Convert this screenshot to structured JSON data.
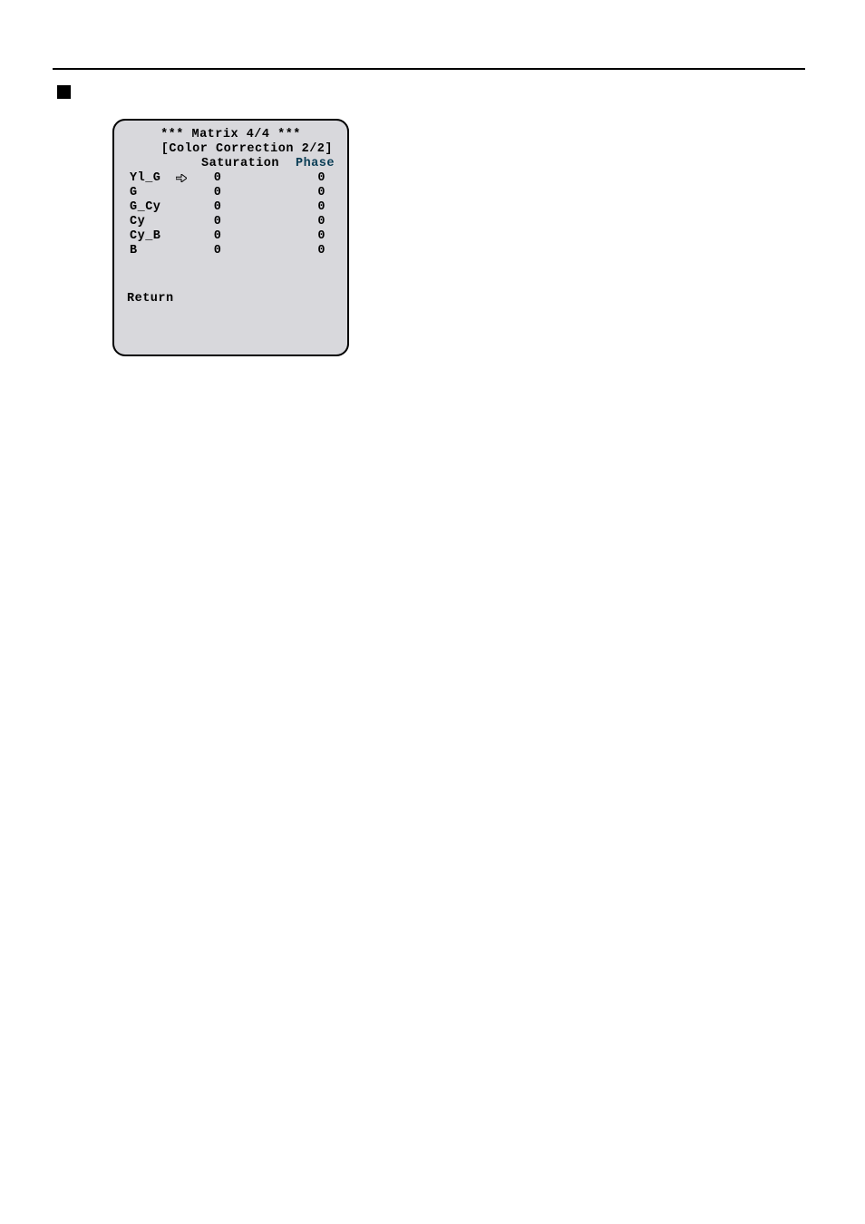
{
  "menu": {
    "title": "*** Matrix 4/4 ***",
    "subtitle": "[Color Correction 2/2]",
    "headers": {
      "saturation": "Saturation",
      "phase": "Phase"
    },
    "rows": [
      {
        "name": "Yl_G",
        "cursor": true,
        "saturation": "0",
        "phase": "0"
      },
      {
        "name": "G",
        "cursor": false,
        "saturation": "0",
        "phase": "0"
      },
      {
        "name": "G_Cy",
        "cursor": false,
        "saturation": "0",
        "phase": "0"
      },
      {
        "name": "Cy",
        "cursor": false,
        "saturation": "0",
        "phase": "0"
      },
      {
        "name": "Cy_B",
        "cursor": false,
        "saturation": "0",
        "phase": "0"
      },
      {
        "name": "B",
        "cursor": false,
        "saturation": "0",
        "phase": "0"
      }
    ],
    "return": "Return"
  }
}
